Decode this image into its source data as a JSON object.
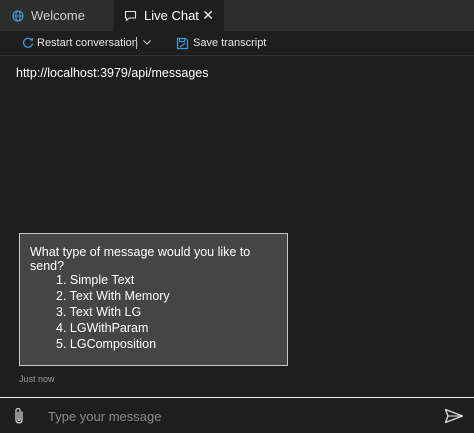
{
  "tabs": [
    {
      "label": "Welcome",
      "icon": "globe-icon",
      "active": false
    },
    {
      "label": "Live Chat",
      "icon": "chat-icon",
      "active": true,
      "close_icon": "close-icon",
      "close_glyph": "✕"
    }
  ],
  "toolbar": {
    "restart_label": "Restart conversation",
    "restart_icon": "restart-icon",
    "dropdown_icon": "chevron-down-icon",
    "save_label": "Save transcript",
    "save_icon": "save-transcript-icon"
  },
  "chat": {
    "endpoint": "http://localhost:3979/api/messages",
    "bot_message": {
      "question": "What type of message would you like to send?",
      "options": [
        "1. Simple Text",
        "2. Text With Memory",
        "3. Text With LG",
        "4. LGWithParam",
        "5. LGComposition"
      ],
      "timestamp": "Just now"
    }
  },
  "input": {
    "placeholder": "Type your message",
    "value": "",
    "attach_icon": "paperclip-icon",
    "send_icon": "send-icon"
  },
  "colors": {
    "background": "#1e1e1e",
    "tabbar": "#2d2d2d",
    "card": "#454545",
    "accent": "#3c9bd6"
  }
}
